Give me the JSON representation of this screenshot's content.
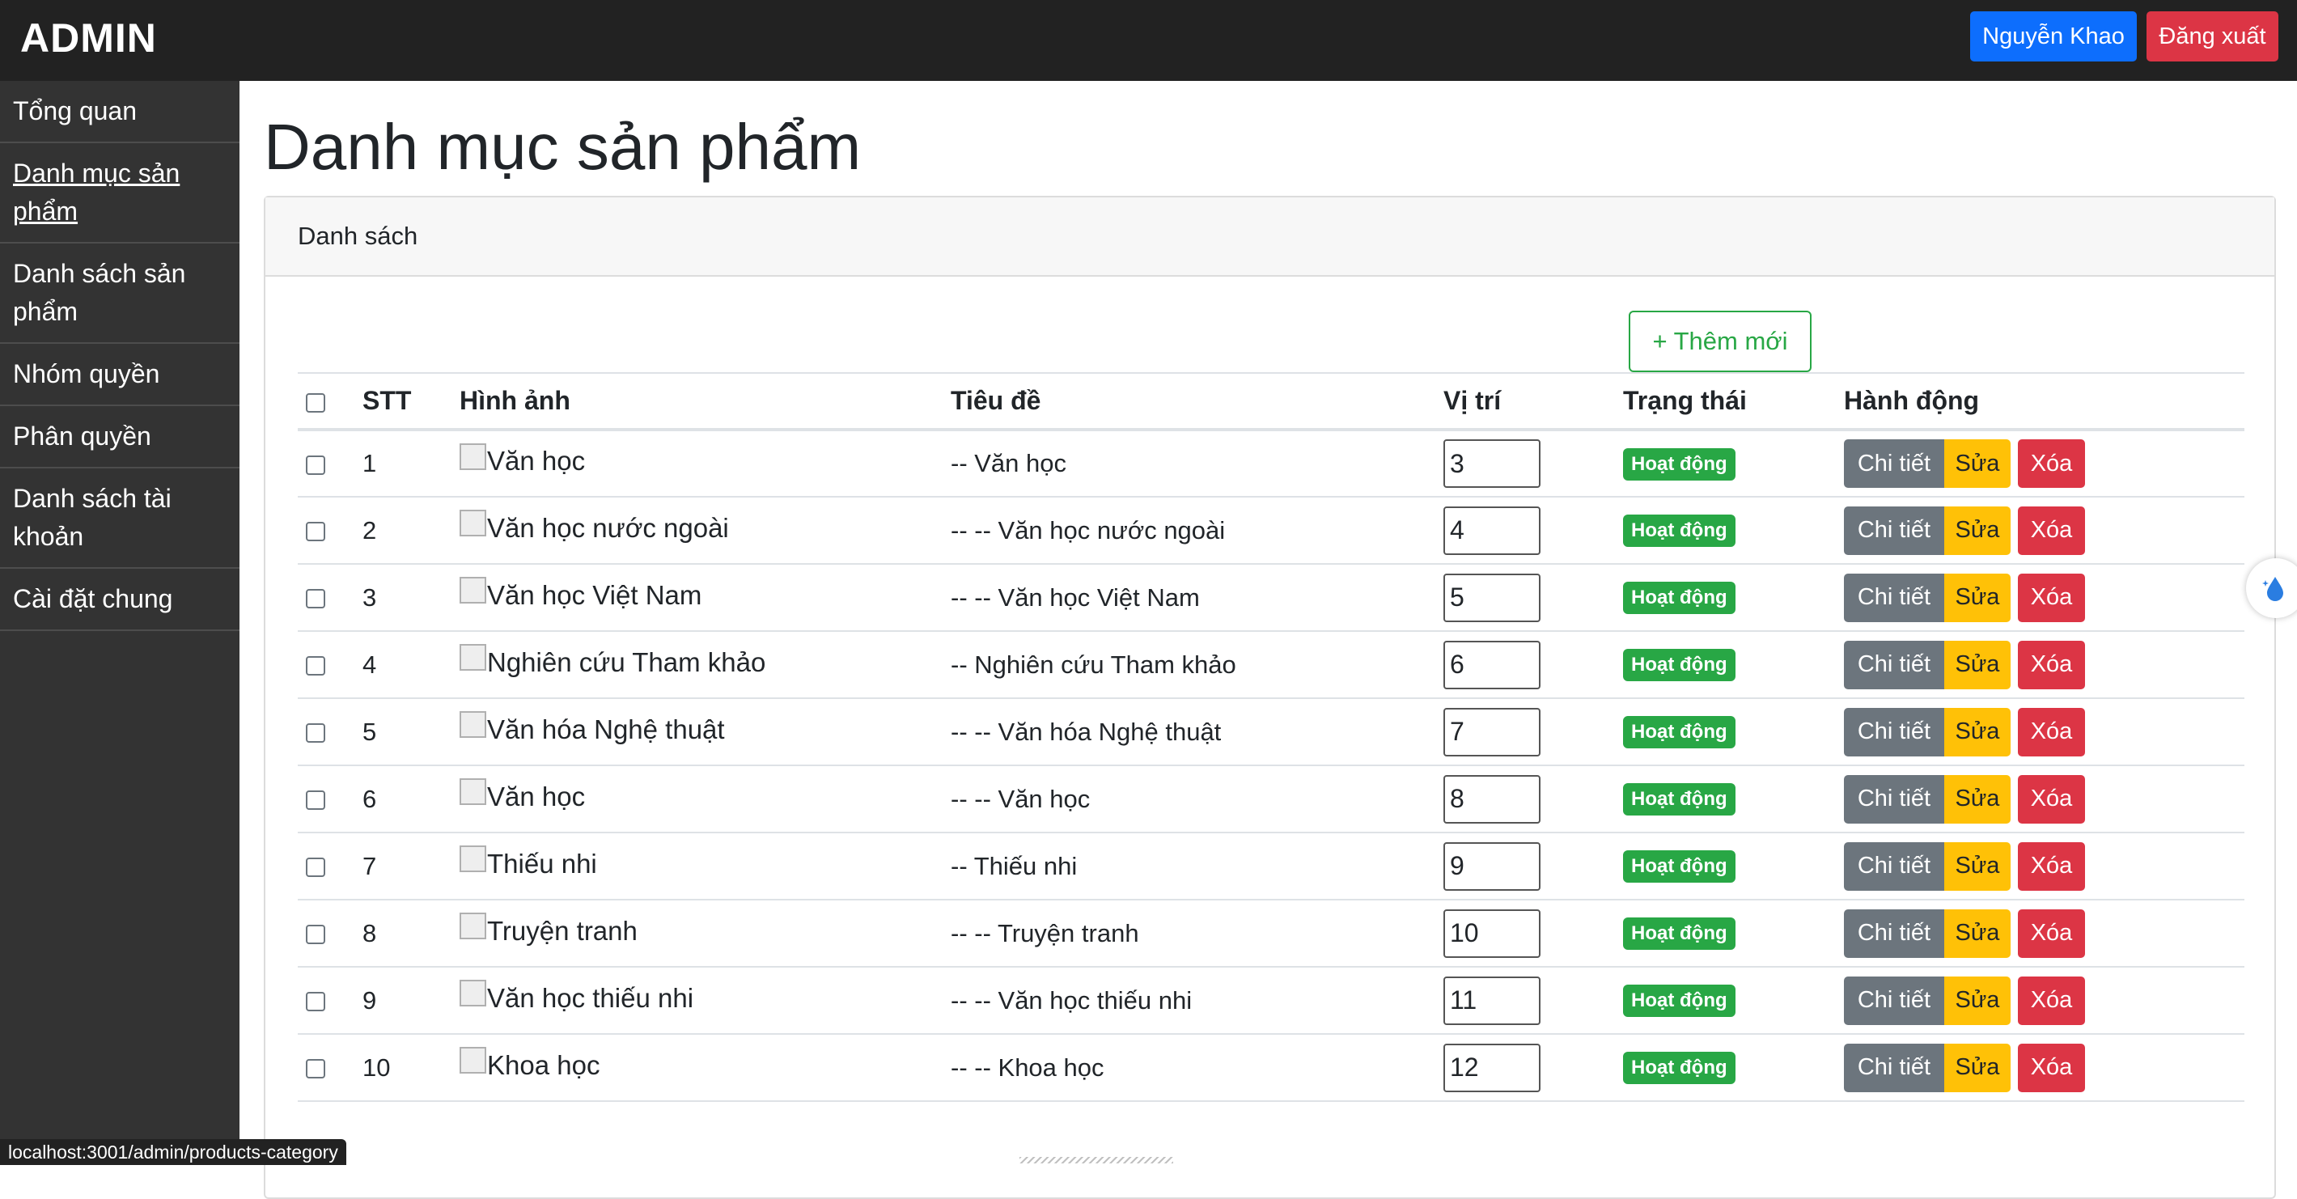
{
  "header": {
    "brand": "ADMIN",
    "user_button": "Nguyễn Khao",
    "logout_button": "Đăng xuất"
  },
  "sidebar": {
    "items": [
      {
        "label": "Tổng quan",
        "active": false
      },
      {
        "label": "Danh mục sản phẩm",
        "active": true
      },
      {
        "label": "Danh sách sản phẩm",
        "active": false
      },
      {
        "label": "Nhóm quyền",
        "active": false
      },
      {
        "label": "Phân quyền",
        "active": false
      },
      {
        "label": "Danh sách tài khoản",
        "active": false
      },
      {
        "label": "Cài đặt chung",
        "active": false
      }
    ]
  },
  "main": {
    "page_title": "Danh mục sản phẩm",
    "card_header": "Danh sách",
    "add_button": "+ Thêm mới",
    "table": {
      "headers": [
        "STT",
        "Hình ảnh",
        "Tiêu đề",
        "Vị trí",
        "Trạng thái",
        "Hành động"
      ],
      "rows": [
        {
          "stt": "1",
          "image_alt": "Văn học",
          "title": "-- Văn học",
          "position": "3",
          "status": "Hoạt động"
        },
        {
          "stt": "2",
          "image_alt": "Văn học nước ngoài",
          "title": "-- -- Văn học nước ngoài",
          "position": "4",
          "status": "Hoạt động"
        },
        {
          "stt": "3",
          "image_alt": "Văn học Việt Nam",
          "title": "-- -- Văn học Việt Nam",
          "position": "5",
          "status": "Hoạt động"
        },
        {
          "stt": "4",
          "image_alt": "Nghiên cứu Tham khảo",
          "title": "-- Nghiên cứu Tham khảo",
          "position": "6",
          "status": "Hoạt động"
        },
        {
          "stt": "5",
          "image_alt": "Văn hóa Nghệ thuật",
          "title": "-- -- Văn hóa Nghệ thuật",
          "position": "7",
          "status": "Hoạt động"
        },
        {
          "stt": "6",
          "image_alt": "Văn học",
          "title": "-- -- Văn học",
          "position": "8",
          "status": "Hoạt động"
        },
        {
          "stt": "7",
          "image_alt": "Thiếu nhi",
          "title": "-- Thiếu nhi",
          "position": "9",
          "status": "Hoạt động"
        },
        {
          "stt": "8",
          "image_alt": "Truyện tranh",
          "title": "-- -- Truyện tranh",
          "position": "10",
          "status": "Hoạt động"
        },
        {
          "stt": "9",
          "image_alt": "Văn học thiếu nhi",
          "title": "-- -- Văn học thiếu nhi",
          "position": "11",
          "status": "Hoạt động"
        },
        {
          "stt": "10",
          "image_alt": "Khoa học",
          "title": "-- -- Khoa học",
          "position": "12",
          "status": "Hoạt động"
        }
      ],
      "action_labels": {
        "detail": "Chi tiết",
        "edit": "Sửa",
        "delete": "Xóa"
      }
    }
  },
  "status_bar_url": "localhost:3001/admin/products-category",
  "colors": {
    "topbar": "#222222",
    "sidebar": "#333333",
    "primary": "#0d6efd",
    "danger": "#dc3545",
    "success": "#28a745",
    "warning": "#ffc107",
    "secondary": "#6c757d"
  }
}
